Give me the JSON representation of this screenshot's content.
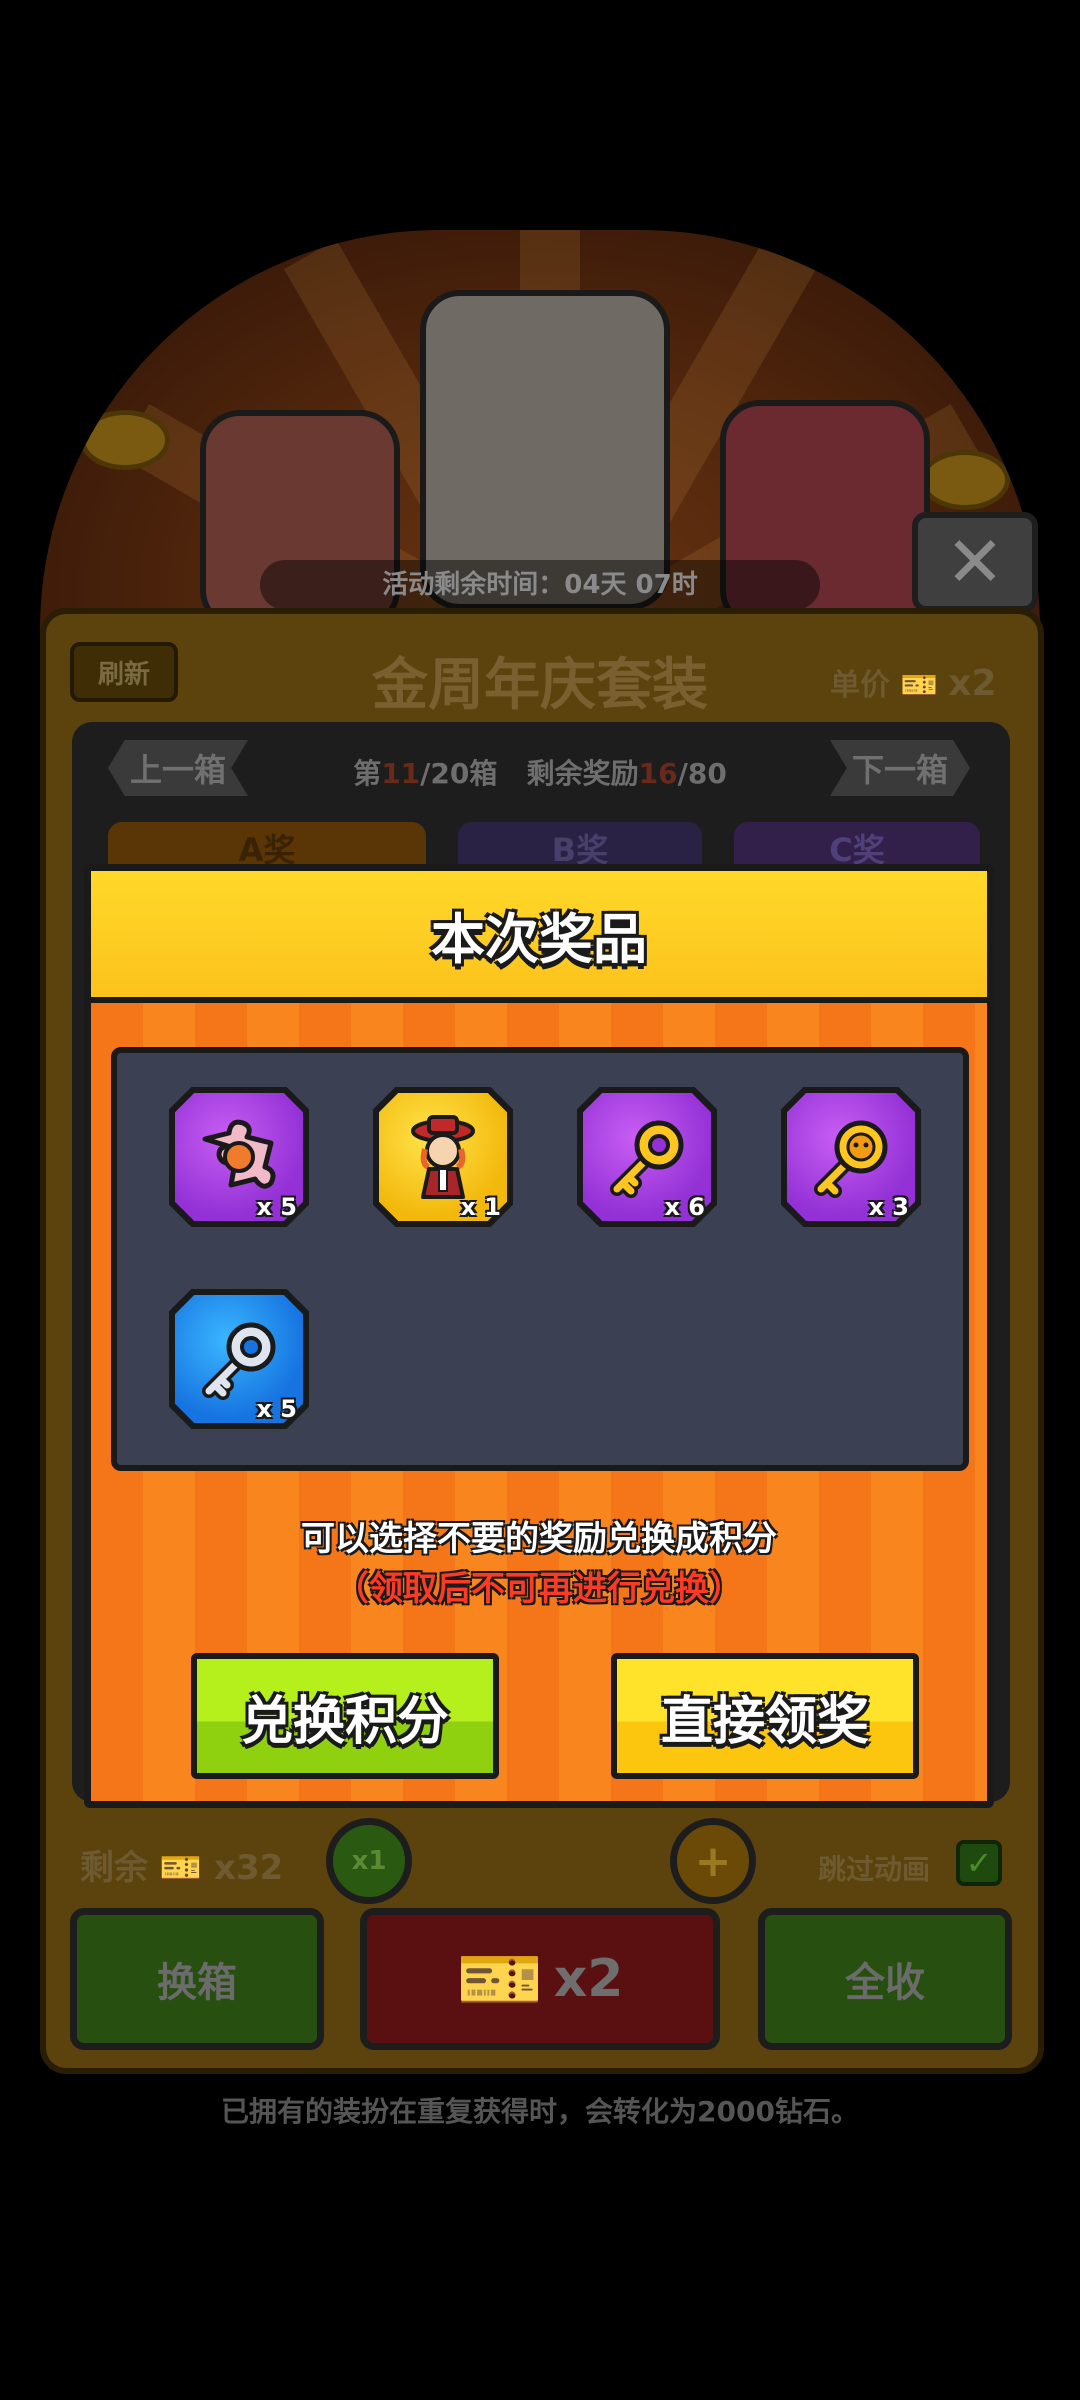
{
  "background": {
    "close_symbol": "✕",
    "activity_timer": "活动剩余时间：04天 07时",
    "refresh_label": "刷新",
    "panel_title": "金周年庆套装",
    "unit_price_label": "单价",
    "unit_price_value": "x2",
    "prev_box": "上一箱",
    "next_box": "下一箱",
    "box_progress": {
      "prefix": "第",
      "current": "11",
      "total": "/20箱",
      "reward_prefix": "剩余奖励",
      "reward_current": "16",
      "reward_total": "/80"
    },
    "tiers": [
      "A奖",
      "B奖",
      "C奖"
    ],
    "remaining_label": "剩余",
    "remaining_value": "x32",
    "skip_animation_label": "跳过动画",
    "multiplier_label": "x1",
    "change_box_label": "换箱",
    "draw_multiplier": "x2",
    "collect_all_label": "全收",
    "footer_note": "已拥有的装扮在重复获得时，会转化为2000钻石。"
  },
  "modal": {
    "title": "本次奖品",
    "items": [
      {
        "icon": "puzzle-piece-icon",
        "rarity": "purple",
        "quantity": "x 5"
      },
      {
        "icon": "character-avatar-icon",
        "rarity": "gold",
        "quantity": "x 1"
      },
      {
        "icon": "gold-key-icon",
        "rarity": "purple",
        "quantity": "x 6"
      },
      {
        "icon": "gold-emblem-key-icon",
        "rarity": "purple",
        "quantity": "x 3"
      },
      {
        "icon": "silver-key-icon",
        "rarity": "blue",
        "quantity": "x 5"
      }
    ],
    "description": "可以选择不要的奖励兑换成积分",
    "warning": "（领取后不可再进行兑换）",
    "exchange_button": "兑换积分",
    "claim_button": "直接领奖"
  },
  "colors": {
    "modal_orange": "#f47618",
    "header_yellow": "#fcc21c",
    "reward_panel": "#3b4152",
    "rarity_purple": "#9331d6",
    "rarity_gold": "#f3b80c",
    "rarity_blue": "#1673e0",
    "warning_red": "#ff3a24",
    "button_green": "#8fd10e",
    "button_yellow": "#fcc60f"
  }
}
